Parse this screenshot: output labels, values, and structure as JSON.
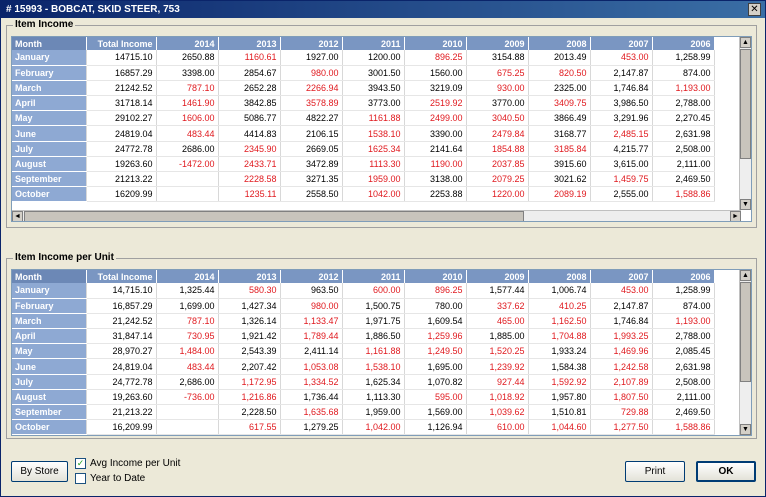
{
  "window": {
    "title": "# 15993 - BOBCAT, SKID STEER, 753",
    "close_glyph": "✕"
  },
  "columns": [
    "Month",
    "Total Income",
    "2014",
    "2013",
    "2012",
    "2011",
    "2010",
    "2009",
    "2008",
    "2007",
    "2006"
  ],
  "item_income": {
    "label": "Item Income",
    "rows": [
      {
        "month": "January",
        "cells": [
          "14715.10",
          "2650.88",
          "1160.61",
          "1927.00",
          "1200.00",
          "896.25",
          "3154.88",
          "2013.49",
          "453.00",
          "1,258.99"
        ],
        "neg": [
          false,
          false,
          true,
          false,
          false,
          true,
          false,
          false,
          true,
          false
        ]
      },
      {
        "month": "February",
        "cells": [
          "16857.29",
          "3398.00",
          "2854.67",
          "980.00",
          "3001.50",
          "1560.00",
          "675.25",
          "820.50",
          "2,147.87",
          "874.00"
        ],
        "neg": [
          false,
          false,
          false,
          true,
          false,
          false,
          true,
          true,
          false,
          false
        ]
      },
      {
        "month": "March",
        "cells": [
          "21242.52",
          "787.10",
          "2652.28",
          "2266.94",
          "3943.50",
          "3219.09",
          "930.00",
          "2325.00",
          "1,746.84",
          "1,193.00"
        ],
        "neg": [
          false,
          true,
          false,
          true,
          false,
          false,
          true,
          false,
          false,
          true
        ]
      },
      {
        "month": "April",
        "cells": [
          "31718.14",
          "1461.90",
          "3842.85",
          "3578.89",
          "3773.00",
          "2519.92",
          "3770.00",
          "3409.75",
          "3,986.50",
          "2,788.00"
        ],
        "neg": [
          false,
          true,
          false,
          true,
          false,
          true,
          false,
          true,
          false,
          false
        ]
      },
      {
        "month": "May",
        "cells": [
          "29102.27",
          "1606.00",
          "5086.77",
          "4822.27",
          "1161.88",
          "2499.00",
          "3040.50",
          "3866.49",
          "3,291.96",
          "2,270.45"
        ],
        "neg": [
          false,
          true,
          false,
          false,
          true,
          true,
          true,
          false,
          false,
          false
        ]
      },
      {
        "month": "June",
        "cells": [
          "24819.04",
          "483.44",
          "4414.83",
          "2106.15",
          "1538.10",
          "3390.00",
          "2479.84",
          "3168.77",
          "2,485.15",
          "2,631.98"
        ],
        "neg": [
          false,
          true,
          false,
          false,
          true,
          false,
          true,
          false,
          true,
          false
        ]
      },
      {
        "month": "July",
        "cells": [
          "24772.78",
          "2686.00",
          "2345.90",
          "2669.05",
          "1625.34",
          "2141.64",
          "1854.88",
          "3185.84",
          "4,215.77",
          "2,508.00"
        ],
        "neg": [
          false,
          false,
          true,
          false,
          true,
          false,
          true,
          true,
          false,
          false
        ]
      },
      {
        "month": "August",
        "cells": [
          "19263.60",
          "-1472.00",
          "2433.71",
          "3472.89",
          "1113.30",
          "1190.00",
          "2037.85",
          "3915.60",
          "3,615.00",
          "2,111.00"
        ],
        "neg": [
          false,
          true,
          true,
          false,
          true,
          true,
          true,
          false,
          false,
          false
        ]
      },
      {
        "month": "September",
        "cells": [
          "21213.22",
          "",
          "2228.58",
          "3271.35",
          "1959.00",
          "3138.00",
          "2079.25",
          "3021.62",
          "1,459.75",
          "2,469.50"
        ],
        "neg": [
          false,
          false,
          true,
          false,
          true,
          false,
          true,
          false,
          true,
          false
        ]
      },
      {
        "month": "October",
        "cells": [
          "16209.99",
          "",
          "1235.11",
          "2558.50",
          "1042.00",
          "2253.88",
          "1220.00",
          "2089.19",
          "2,555.00",
          "1,588.86"
        ],
        "neg": [
          false,
          false,
          true,
          false,
          true,
          false,
          true,
          true,
          false,
          true
        ]
      }
    ]
  },
  "item_income_per_unit": {
    "label": "Item Income per Unit",
    "rows": [
      {
        "month": "January",
        "cells": [
          "14,715.10",
          "1,325.44",
          "580.30",
          "963.50",
          "600.00",
          "896.25",
          "1,577.44",
          "1,006.74",
          "453.00",
          "1,258.99"
        ],
        "neg": [
          false,
          false,
          true,
          false,
          true,
          true,
          false,
          false,
          true,
          false
        ]
      },
      {
        "month": "February",
        "cells": [
          "16,857.29",
          "1,699.00",
          "1,427.34",
          "980.00",
          "1,500.75",
          "780.00",
          "337.62",
          "410.25",
          "2,147.87",
          "874.00"
        ],
        "neg": [
          false,
          false,
          false,
          true,
          false,
          false,
          true,
          true,
          false,
          false
        ]
      },
      {
        "month": "March",
        "cells": [
          "21,242.52",
          "787.10",
          "1,326.14",
          "1,133.47",
          "1,971.75",
          "1,609.54",
          "465.00",
          "1,162.50",
          "1,746.84",
          "1,193.00"
        ],
        "neg": [
          false,
          true,
          false,
          true,
          false,
          false,
          true,
          true,
          false,
          true
        ]
      },
      {
        "month": "April",
        "cells": [
          "31,847.14",
          "730.95",
          "1,921.42",
          "1,789.44",
          "1,886.50",
          "1,259.96",
          "1,885.00",
          "1,704.88",
          "1,993.25",
          "2,788.00"
        ],
        "neg": [
          false,
          true,
          false,
          true,
          false,
          true,
          false,
          true,
          true,
          false
        ]
      },
      {
        "month": "May",
        "cells": [
          "28,970.27",
          "1,484.00",
          "2,543.39",
          "2,411.14",
          "1,161.88",
          "1,249.50",
          "1,520.25",
          "1,933.24",
          "1,469.96",
          "2,085.45"
        ],
        "neg": [
          false,
          true,
          false,
          false,
          true,
          true,
          true,
          false,
          true,
          false
        ]
      },
      {
        "month": "June",
        "cells": [
          "24,819.04",
          "483.44",
          "2,207.42",
          "1,053.08",
          "1,538.10",
          "1,695.00",
          "1,239.92",
          "1,584.38",
          "1,242.58",
          "2,631.98"
        ],
        "neg": [
          false,
          true,
          false,
          true,
          true,
          false,
          true,
          false,
          true,
          false
        ]
      },
      {
        "month": "July",
        "cells": [
          "24,772.78",
          "2,686.00",
          "1,172.95",
          "1,334.52",
          "1,625.34",
          "1,070.82",
          "927.44",
          "1,592.92",
          "2,107.89",
          "2,508.00"
        ],
        "neg": [
          false,
          false,
          true,
          true,
          false,
          false,
          true,
          true,
          true,
          false
        ]
      },
      {
        "month": "August",
        "cells": [
          "19,263.60",
          "-736.00",
          "1,216.86",
          "1,736.44",
          "1,113.30",
          "595.00",
          "1,018.92",
          "1,957.80",
          "1,807.50",
          "2,111.00"
        ],
        "neg": [
          false,
          true,
          true,
          false,
          false,
          true,
          true,
          false,
          true,
          false
        ]
      },
      {
        "month": "September",
        "cells": [
          "21,213.22",
          "",
          "2,228.50",
          "1,635.68",
          "1,959.00",
          "1,569.00",
          "1,039.62",
          "1,510.81",
          "729.88",
          "2,469.50"
        ],
        "neg": [
          false,
          false,
          false,
          true,
          false,
          false,
          true,
          false,
          true,
          false
        ]
      },
      {
        "month": "October",
        "cells": [
          "16,209.99",
          "",
          "617.55",
          "1,279.25",
          "1,042.00",
          "1,126.94",
          "610.00",
          "1,044.60",
          "1,277.50",
          "1,588.86"
        ],
        "neg": [
          false,
          false,
          true,
          false,
          true,
          false,
          true,
          true,
          true,
          true
        ]
      }
    ]
  },
  "footer": {
    "by_store_label": "By Store",
    "avg_income_label": "Avg Income per Unit",
    "avg_income_checked": true,
    "year_to_date_label": "Year to Date",
    "year_to_date_checked": false,
    "check_glyph": "✓",
    "print_label": "Print",
    "ok_label": "OK"
  },
  "scroll_glyphs": {
    "up": "▲",
    "down": "▼",
    "left": "◄",
    "right": "►"
  },
  "colors": {
    "negative": "#e0191e",
    "header": "#7a96c2",
    "month_cell": "#8ea9d3"
  }
}
